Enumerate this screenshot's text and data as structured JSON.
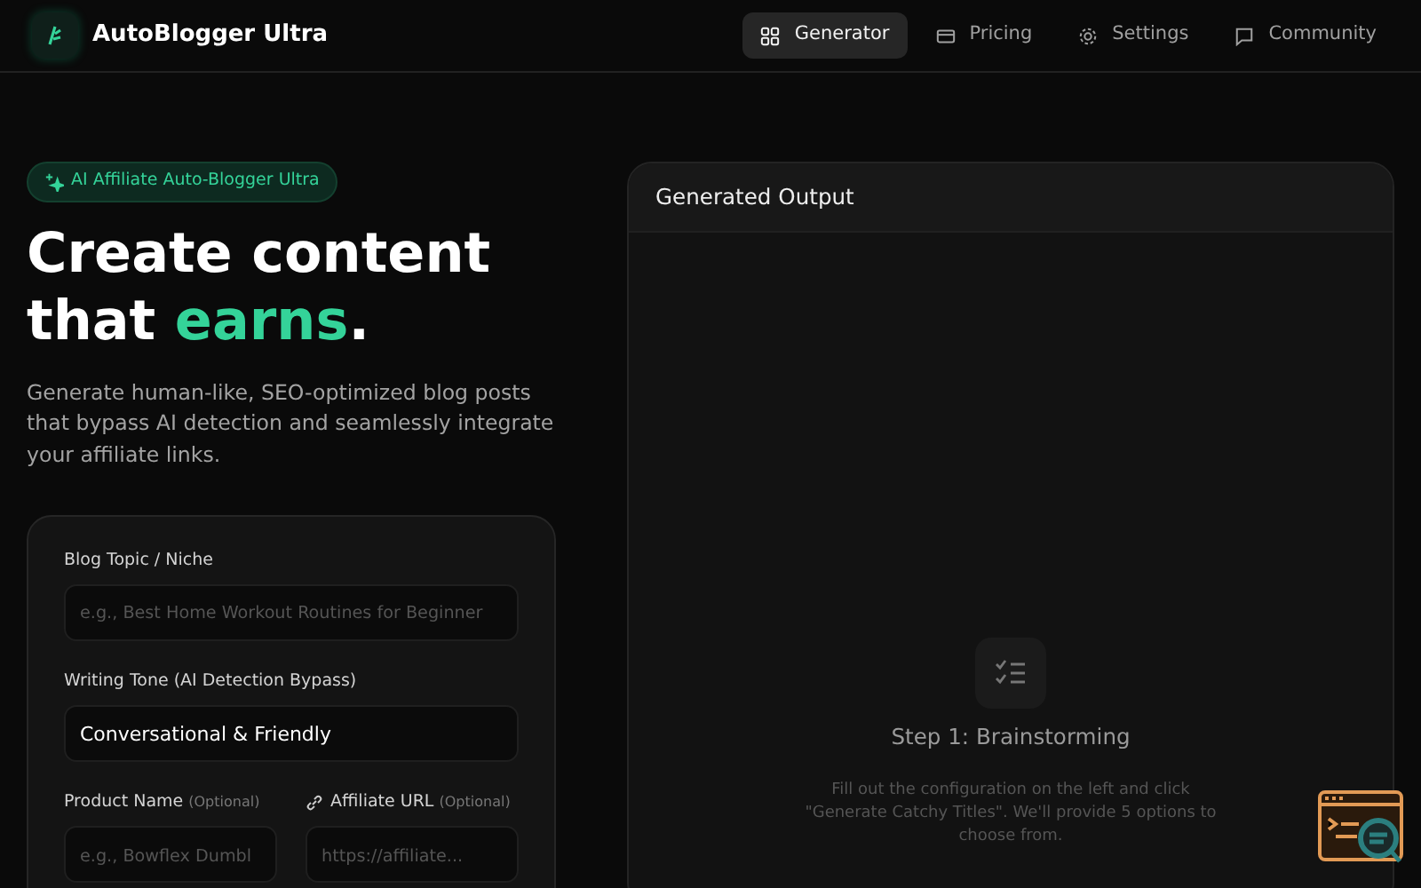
{
  "brand": {
    "name": "AutoBlogger Ultra"
  },
  "nav": [
    {
      "label": "Generator",
      "selected": true
    },
    {
      "label": "Pricing",
      "selected": false
    },
    {
      "label": "Settings",
      "selected": false
    },
    {
      "label": "Community",
      "selected": false
    }
  ],
  "hero": {
    "badge": "AI Affiliate Auto-Blogger Ultra",
    "headline_before": "Create content that",
    "headline_highlight": "earns",
    "headline_after": ".",
    "description": "Generate human-like, SEO-optimized blog posts that bypass AI detection and seamlessly integrate your affiliate links."
  },
  "form": {
    "topic": {
      "label": "Blog Topic / Niche",
      "placeholder": "e.g., Best Home Workout Routines for Beginner"
    },
    "tone": {
      "label": "Writing Tone (AI Detection Bypass)",
      "value": "Conversational & Friendly"
    },
    "product": {
      "label": "Product Name",
      "optional": "(Optional)",
      "placeholder": "e.g., Bowflex Dumbl"
    },
    "affiliate": {
      "label": "Affiliate URL",
      "optional": "(Optional)",
      "placeholder": "https://affiliate..."
    }
  },
  "output": {
    "title": "Generated Output",
    "step_title": "Step 1: Brainstorming",
    "step_text": "Fill out the configuration on the left and click \"Generate Catchy Titles\". We'll provide 5 options to choose from."
  }
}
